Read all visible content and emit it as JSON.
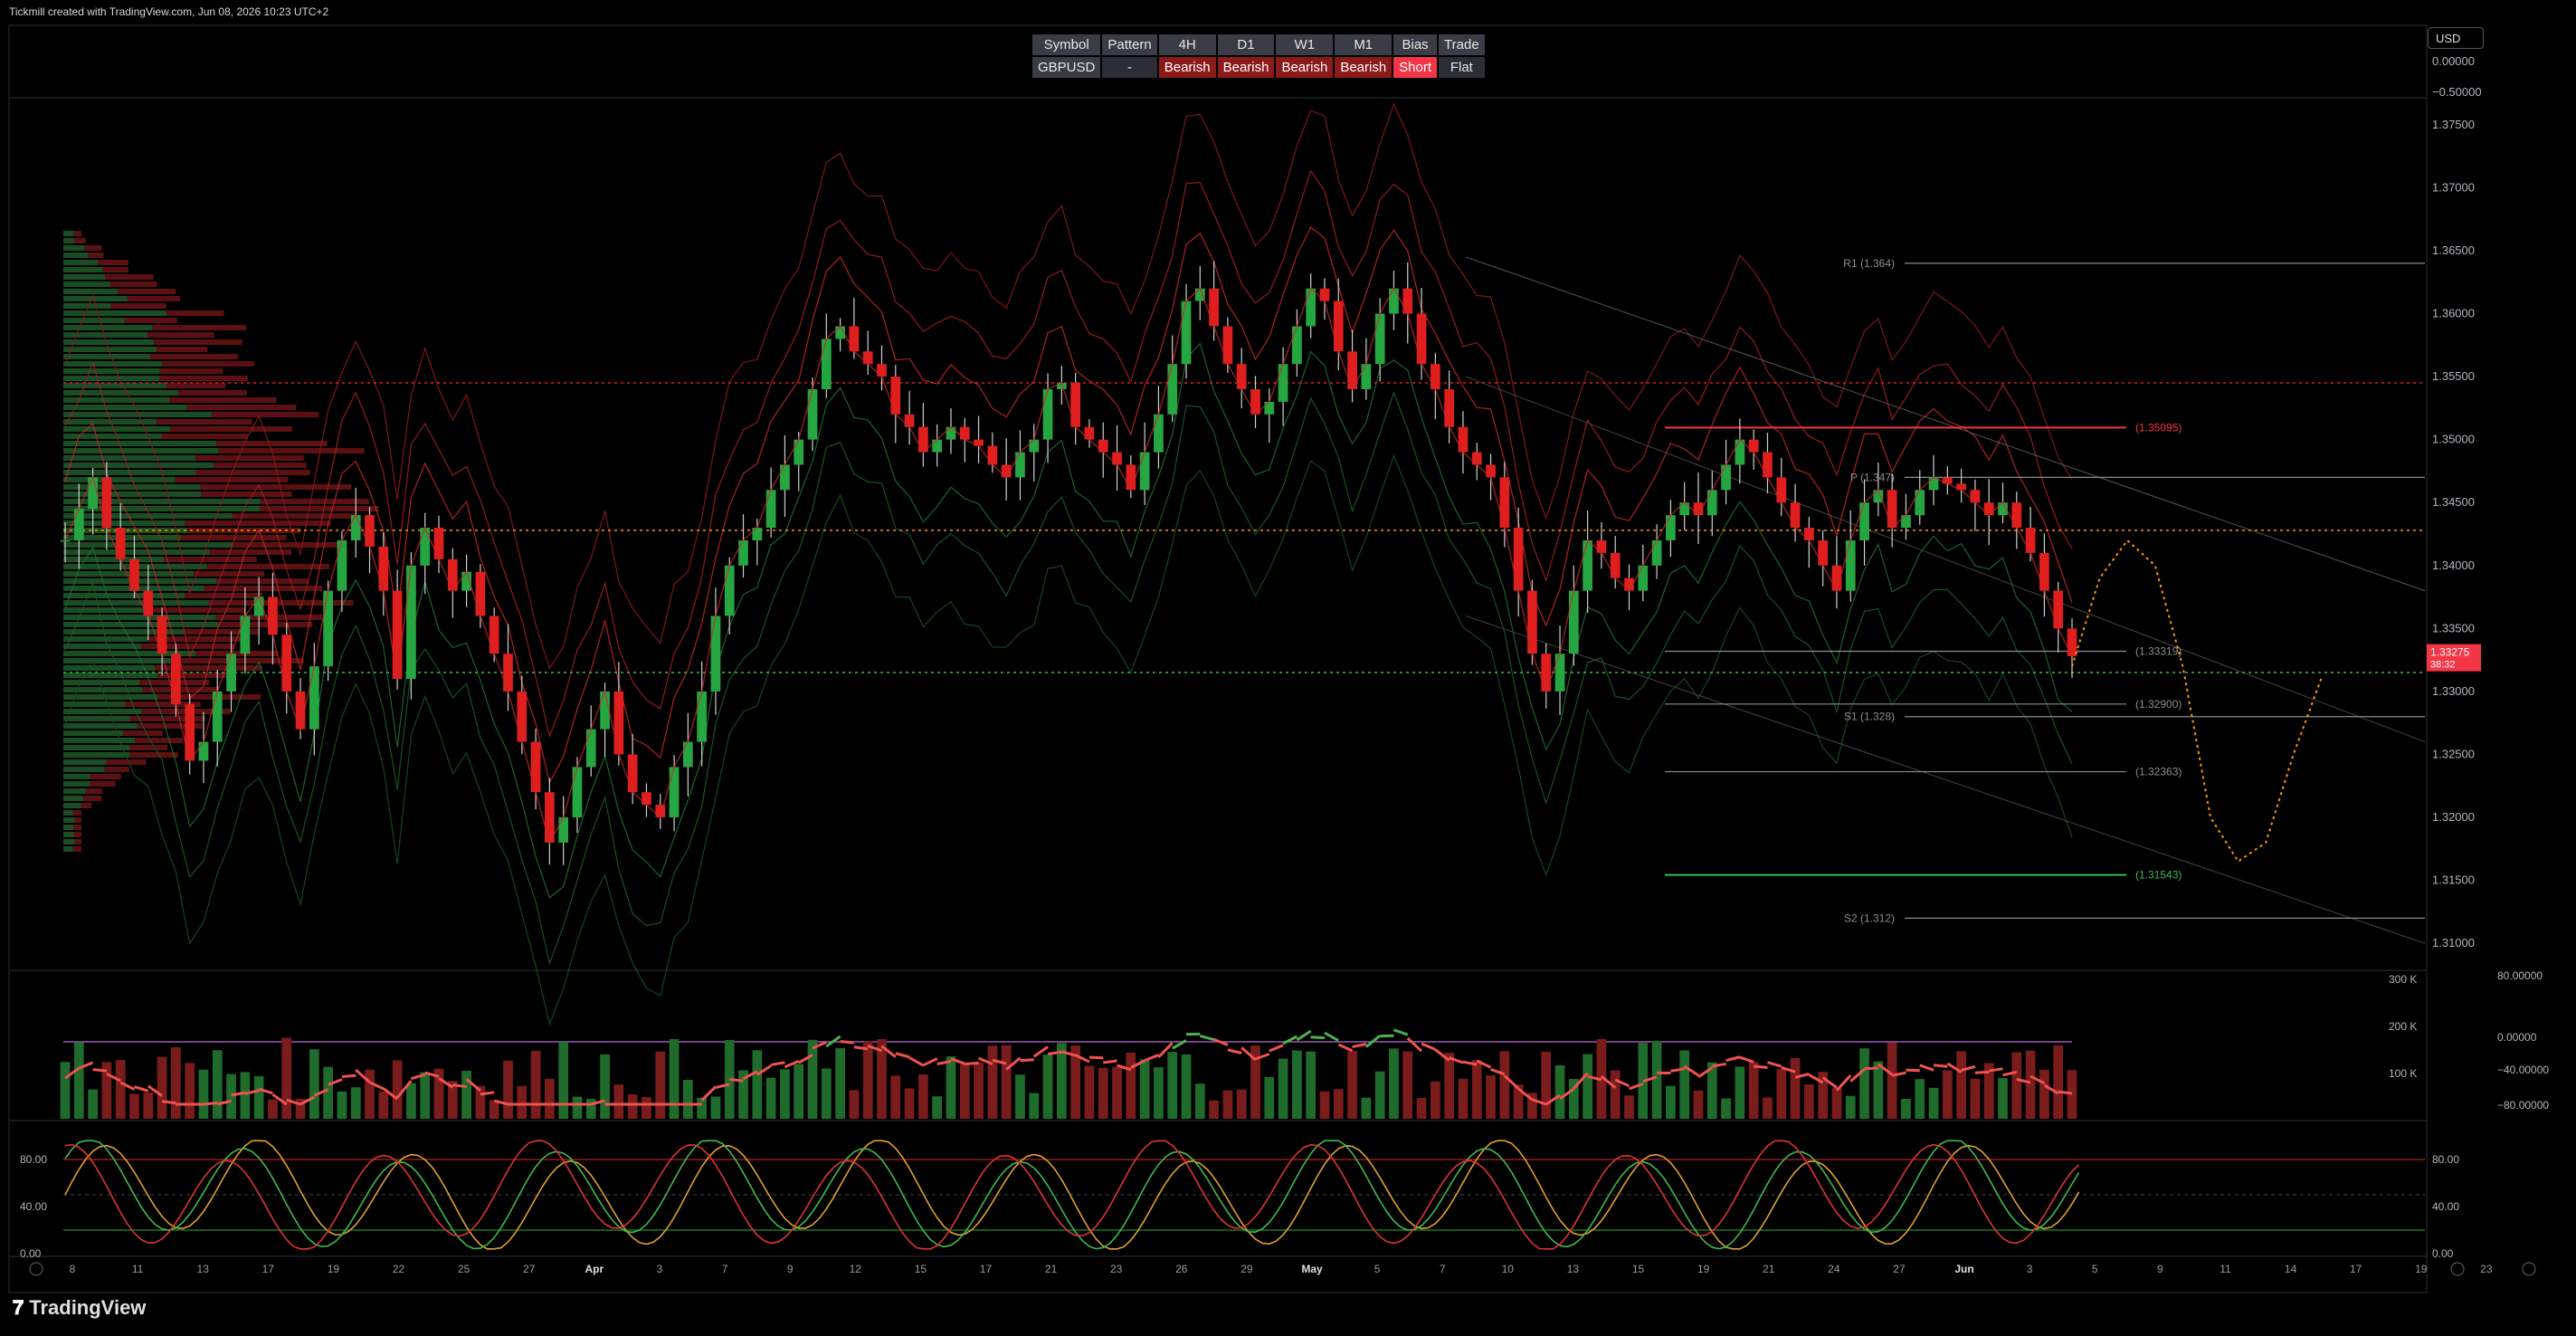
{
  "header": {
    "text": "Tickmill created with TradingView.com, Jun 08, 2026 10:23 UTC+2"
  },
  "currency": "USD",
  "signal_table": {
    "headers": [
      "Symbol",
      "Pattern",
      "4H",
      "D1",
      "W1",
      "M1",
      "Bias",
      "Trade"
    ],
    "values": [
      "GBPUSD",
      "-",
      "Bearish",
      "Bearish",
      "Bearish",
      "Bearish",
      "Short",
      "Flat"
    ]
  },
  "colors": {
    "bull": "#26a641",
    "bear": "#e01e1e",
    "accent_red": "#f23645",
    "orange": "#ff9800",
    "purple": "#9b59b6",
    "gray_line": "#8c8c8c"
  },
  "chart_data": [
    {
      "type": "candlestick",
      "symbol": "GBPUSD",
      "ylim": [
        1.308,
        1.377
      ],
      "price_ticks": [
        1.375,
        1.37,
        1.365,
        1.36,
        1.355,
        1.35,
        1.345,
        1.34,
        1.335,
        1.33,
        1.325,
        1.32,
        1.315,
        1.31
      ],
      "top_axis_ticks": [
        "0.00000",
        "−0.50000"
      ],
      "x_ticks": [
        "8",
        "11",
        "13",
        "17",
        "19",
        "22",
        "25",
        "27",
        "Apr",
        "3",
        "7",
        "9",
        "12",
        "15",
        "17",
        "21",
        "23",
        "26",
        "29",
        "May",
        "5",
        "7",
        "10",
        "13",
        "15",
        "19",
        "21",
        "24",
        "27",
        "Jun",
        "3",
        "5",
        "9",
        "11",
        "14",
        "17",
        "19",
        "23"
      ],
      "close_series": [
        1.342,
        1.3445,
        1.347,
        1.343,
        1.3405,
        1.338,
        1.336,
        1.333,
        1.329,
        1.3245,
        1.326,
        1.33,
        1.333,
        1.336,
        1.3375,
        1.3345,
        1.33,
        1.327,
        1.332,
        1.338,
        1.342,
        1.344,
        1.3415,
        1.338,
        1.331,
        1.34,
        1.343,
        1.3405,
        1.338,
        1.3395,
        1.336,
        1.333,
        1.33,
        1.326,
        1.322,
        1.318,
        1.32,
        1.324,
        1.327,
        1.33,
        1.325,
        1.322,
        1.321,
        1.32,
        1.324,
        1.326,
        1.33,
        1.336,
        1.34,
        1.342,
        1.343,
        1.346,
        1.348,
        1.35,
        1.354,
        1.358,
        1.359,
        1.357,
        1.356,
        1.355,
        1.352,
        1.351,
        1.349,
        1.35,
        1.351,
        1.35,
        1.3495,
        1.348,
        1.347,
        1.349,
        1.35,
        1.354,
        1.3545,
        1.351,
        1.35,
        1.349,
        1.348,
        1.346,
        1.349,
        1.352,
        1.356,
        1.361,
        1.362,
        1.359,
        1.356,
        1.354,
        1.352,
        1.353,
        1.356,
        1.359,
        1.362,
        1.361,
        1.357,
        1.354,
        1.356,
        1.36,
        1.362,
        1.36,
        1.356,
        1.354,
        1.351,
        1.349,
        1.348,
        1.347,
        1.343,
        1.338,
        1.333,
        1.33,
        1.333,
        1.338,
        1.342,
        1.341,
        1.339,
        1.338,
        1.34,
        1.342,
        1.344,
        1.345,
        1.344,
        1.346,
        1.348,
        1.35,
        1.349,
        1.347,
        1.345,
        1.343,
        1.342,
        1.34,
        1.338,
        1.342,
        1.345,
        1.346,
        1.343,
        1.344,
        1.346,
        1.347,
        1.3465,
        1.346,
        1.345,
        1.344,
        1.345,
        1.343,
        1.341,
        1.338,
        1.335,
        1.3328
      ],
      "last_price": {
        "value": "1.33275",
        "countdown": "38:32"
      },
      "levels": [
        {
          "label": "R1 (1.364)",
          "value": 1.364
        },
        {
          "label": "(1.35095)",
          "value": 1.35095
        },
        {
          "label": "P (1.347)",
          "value": 1.347
        },
        {
          "label": "(1.33319)",
          "value": 1.33319
        },
        {
          "label": "S1 (1.328)",
          "value": 1.328
        },
        {
          "label": "(1.32900)",
          "value": 1.329
        },
        {
          "label": "(1.32363)",
          "value": 1.32363
        },
        {
          "label": "(1.31543)",
          "value": 1.31543
        },
        {
          "label": "S2 (1.312)",
          "value": 1.312
        }
      ],
      "dotted_levels": [
        1.3545,
        1.3428,
        1.3315
      ],
      "forecast_path": [
        [
          145,
          1.332
        ],
        [
          147,
          1.339
        ],
        [
          149,
          1.342
        ],
        [
          151,
          1.34
        ],
        [
          153,
          1.332
        ],
        [
          155,
          1.32
        ],
        [
          157,
          1.3165
        ],
        [
          159,
          1.318
        ],
        [
          161,
          1.325
        ],
        [
          163,
          1.331
        ]
      ]
    },
    {
      "type": "bar+line",
      "name": "volume_rsi",
      "volume_ticks": [
        "300 K",
        "200 K",
        "100 K"
      ],
      "right_ticks": [
        "80.00000",
        "0.00000",
        "−40.00000",
        "−80.00000"
      ]
    },
    {
      "type": "line",
      "name": "stochastic",
      "ylim": [
        0,
        100
      ],
      "ticks": [
        "80.00",
        "40.00",
        "0.00"
      ],
      "levels": [
        80,
        20
      ]
    }
  ],
  "brand": "TradingView"
}
